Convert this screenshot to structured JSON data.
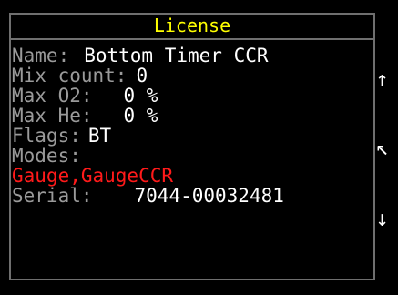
{
  "screen": {
    "title": "License",
    "title_color": "#ffff00",
    "fields": {
      "name_label": "Name:",
      "name_value": "Bottom Timer CCR",
      "mix_count_label": "Mix count:",
      "mix_count_value": "0",
      "max_o2_label": "Max O2:",
      "max_o2_value": "0 %",
      "max_he_label": "Max He:",
      "max_he_value": "0 %",
      "flags_label": "Flags:",
      "flags_value": "BT",
      "modes_label": "Modes:",
      "modes_value": "Gauge,GaugeCCR",
      "serial_label": "Serial:",
      "serial_value": "7044-00032481"
    },
    "icons": {
      "up": "↑",
      "home": "↖",
      "down": "↓"
    }
  }
}
